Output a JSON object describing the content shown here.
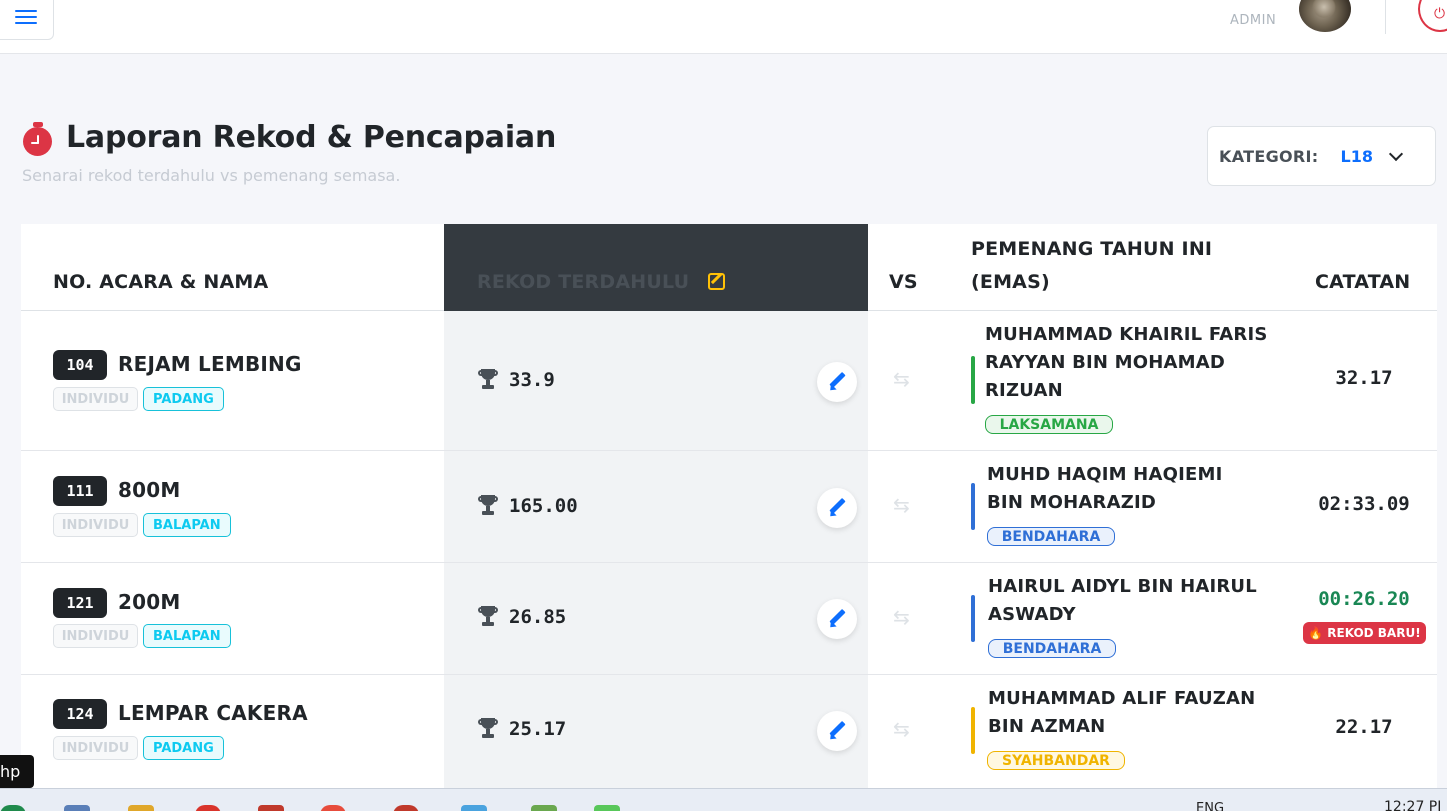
{
  "topbar": {
    "admin_label": "ADMIN"
  },
  "header": {
    "title": "Laporan Rekod & Pencapaian",
    "subtitle": "Senarai rekod terdahulu vs pemenang semasa.",
    "kategori_label": "KATEGORI:",
    "kategori_value": "L18"
  },
  "table": {
    "columns": {
      "event": "NO. ACARA & NAMA",
      "record": "REKOD TERDAHULU",
      "vs": "VS",
      "winner_line1": "PEMENANG TAHUN INI",
      "winner_line2": "(EMAS)",
      "note": "CATATAN"
    },
    "rows": [
      {
        "no": "104",
        "name": "REJAM LEMBING",
        "type": "INDIVIDU",
        "category": "PADANG",
        "record": "33.9",
        "winner": "MUHAMMAD KHAIRIL FARIS RAYYAN BIN MOHAMAD RIZUAN",
        "team": "LAKSAMANA",
        "team_color": "#28a745",
        "team_bg": "#eaf7ec",
        "result": "32.17",
        "new_record": ""
      },
      {
        "no": "111",
        "name": "800M",
        "type": "INDIVIDU",
        "category": "BALAPAN",
        "record": "165.00",
        "winner": "MUHD HAQIM HAQIEMI BIN MOHARAZID",
        "team": "BENDAHARA",
        "team_color": "#2f6fd6",
        "team_bg": "#eaf1fc",
        "result": "02:33.09",
        "new_record": ""
      },
      {
        "no": "121",
        "name": "200M",
        "type": "INDIVIDU",
        "category": "BALAPAN",
        "record": "26.85",
        "winner": "HAIRUL AIDYL BIN HAIRUL ASWADY",
        "team": "BENDAHARA",
        "team_color": "#2f6fd6",
        "team_bg": "#eaf1fc",
        "result": "00:26.20",
        "new_record": "REKOD BARU!"
      },
      {
        "no": "124",
        "name": "LEMPAR CAKERA",
        "type": "INDIVIDU",
        "category": "PADANG",
        "record": "25.17",
        "winner": "MUHAMMAD ALIF FAUZAN BIN AZMAN",
        "team": "SYAHBANDAR",
        "team_color": "#f0b400",
        "team_bg": "#fff8e1",
        "result": "22.17",
        "new_record": ""
      }
    ]
  },
  "tooltip_text": "hp",
  "taskbar": {
    "lang": "ENG",
    "time": "12:27 PI"
  },
  "colors": {
    "accent": "#0d6efd",
    "danger": "#dc3545",
    "success_result": "#198754",
    "dark_header": "#343a40"
  }
}
